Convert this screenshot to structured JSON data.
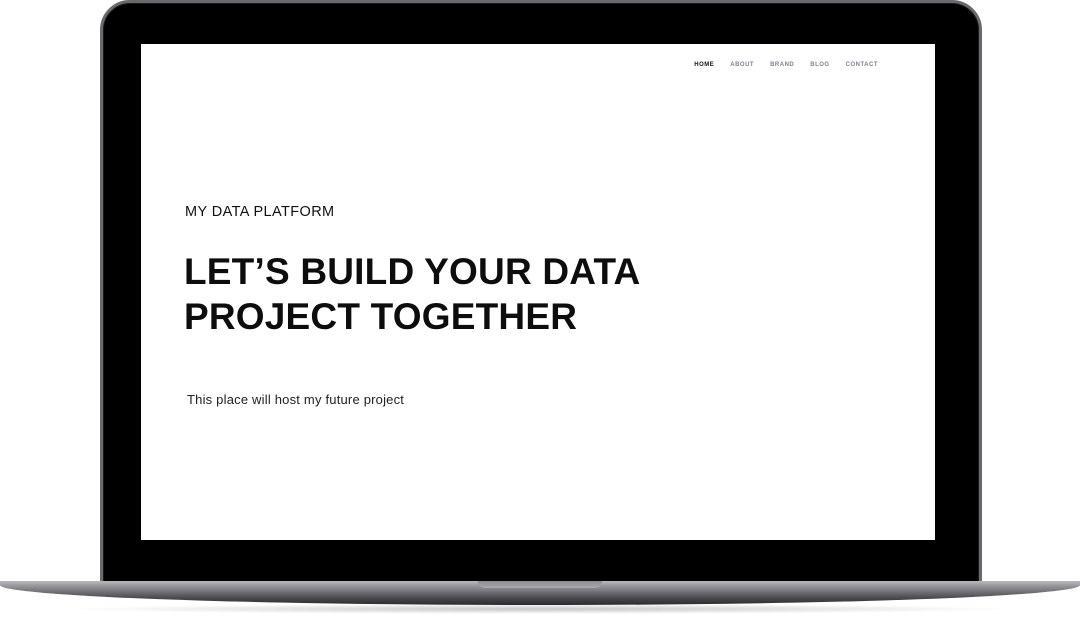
{
  "site": {
    "nav": [
      {
        "label": "HOME",
        "active": true
      },
      {
        "label": "ABOUT",
        "active": false
      },
      {
        "label": "BRAND",
        "active": false
      },
      {
        "label": "BLOG",
        "active": false
      },
      {
        "label": "CONTACT",
        "active": false
      }
    ],
    "kicker": "MY DATA PLATFORM",
    "headline_line1": "LET’S BUILD YOUR DATA",
    "headline_line2": "PROJECT TOGETHER",
    "subtext": "This place will host my future project"
  },
  "colors": {
    "nav_active": "#111111",
    "nav_inactive": "#7a8294",
    "text": "#0d0d0d",
    "screen_bg": "#ffffff",
    "bezel": "#000000"
  }
}
